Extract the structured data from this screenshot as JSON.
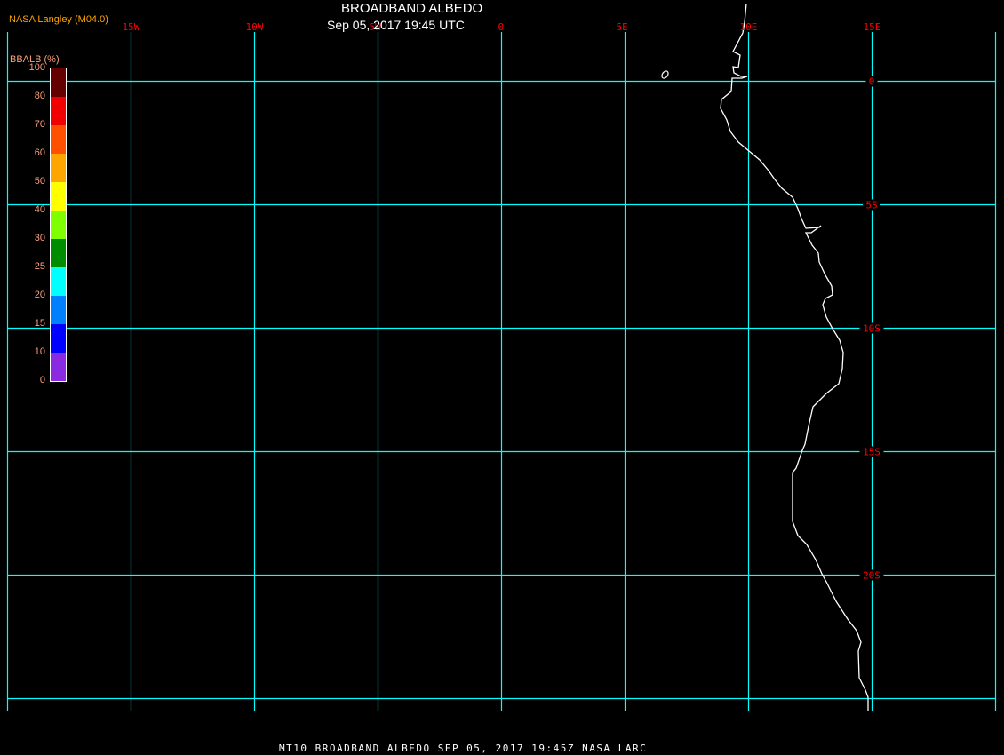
{
  "header": {
    "title": "BROADBAND ALBEDO",
    "datetime": "Sep 05, 2017 19:45 UTC",
    "credit": "NASA Langley (M04.0)"
  },
  "footer": "MT10   BROADBAND ALBEDO   SEP 05, 2017 19:45Z   NASA LARC",
  "colors": {
    "grid": "#00ffff",
    "labels": "#ff0000",
    "coast": "#ffffff",
    "background": "#000000"
  },
  "map": {
    "longitudes": [
      {
        "value": -20,
        "label": ""
      },
      {
        "value": -15,
        "label": "15W"
      },
      {
        "value": -10,
        "label": "10W"
      },
      {
        "value": -5,
        "label": "5W"
      },
      {
        "value": 0,
        "label": "0"
      },
      {
        "value": 5,
        "label": "5E"
      },
      {
        "value": 10,
        "label": "10E"
      },
      {
        "value": 15,
        "label": "15E"
      },
      {
        "value": 20,
        "label": ""
      }
    ],
    "latitudes": [
      {
        "value": 0,
        "label": "0"
      },
      {
        "value": -5,
        "label": "5S"
      },
      {
        "value": -10,
        "label": "10S"
      },
      {
        "value": -15,
        "label": "15S"
      },
      {
        "value": -20,
        "label": "20S"
      },
      {
        "value": -25,
        "label": ""
      }
    ]
  },
  "colorbar": {
    "title": "BBALB (%)",
    "labels": [
      "100",
      "80",
      "70",
      "60",
      "50",
      "40",
      "30",
      "25",
      "20",
      "15",
      "10",
      "0"
    ],
    "colors": [
      "#640000",
      "#f00000",
      "#ff5000",
      "#ffa500",
      "#ffff00",
      "#80ff00",
      "#008c00",
      "#00ffff",
      "#0080ff",
      "#0000ff",
      "#8a2be2"
    ]
  }
}
